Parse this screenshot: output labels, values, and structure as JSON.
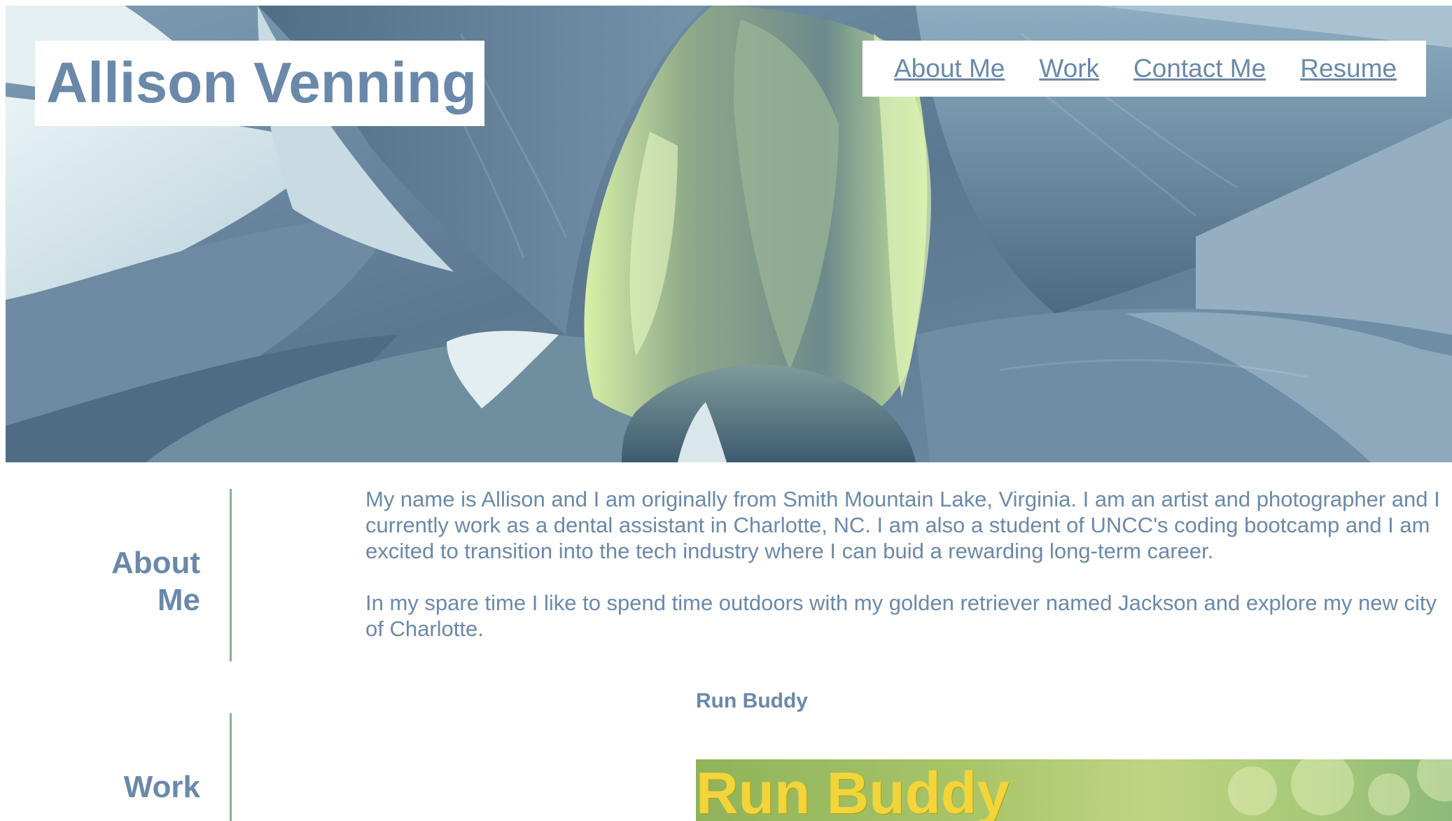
{
  "header": {
    "site_title": "Allison Venning",
    "nav": [
      {
        "label": "About Me"
      },
      {
        "label": "Work"
      },
      {
        "label": "Contact Me"
      },
      {
        "label": "Resume"
      }
    ]
  },
  "about": {
    "heading": "About Me",
    "paragraphs": [
      "My name is Allison and I am originally from Smith Mountain Lake, Virginia. I am an artist and photographer and I currently work as a dental assistant in Charlotte, NC. I am also a student of UNCC's coding bootcamp and I am excited to transition into the tech industry where I can buid a rewarding long-term career.",
      "In my spare time I like to spend time outdoors with my golden retriever named Jackson and explore my new city of Charlotte."
    ]
  },
  "work": {
    "heading": "Work",
    "projects": [
      {
        "title": "Run Buddy",
        "image_text": "Run Buddy"
      }
    ]
  },
  "colors": {
    "primary_text": "#6a89aa",
    "divider": "#86b190",
    "background": "#ffffff"
  }
}
